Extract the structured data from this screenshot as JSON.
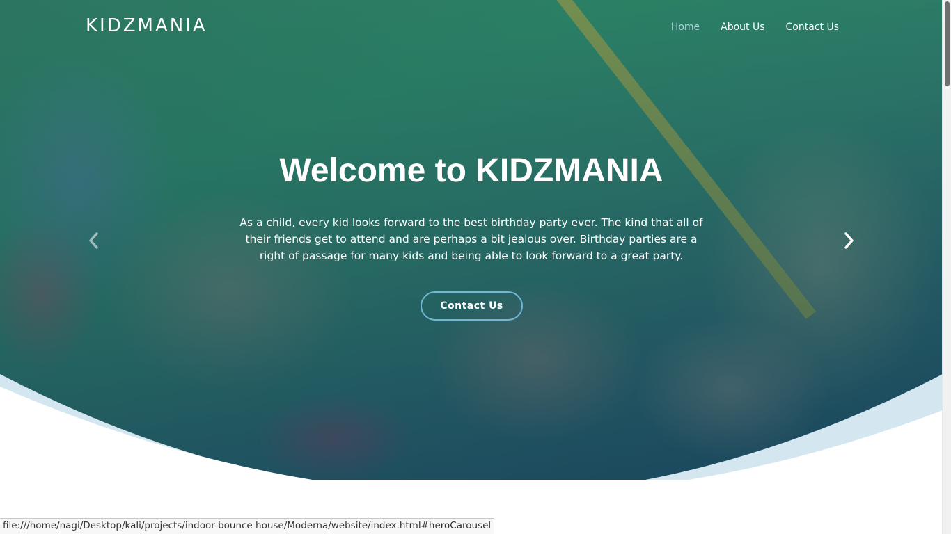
{
  "header": {
    "brand": "KIDZMANIA",
    "nav": [
      {
        "label": "Home",
        "active": true
      },
      {
        "label": "About Us",
        "active": false
      },
      {
        "label": "Contact Us",
        "active": false
      }
    ]
  },
  "hero": {
    "title": "Welcome to KIDZMANIA",
    "text": "As a child, every kid looks forward to the best birthday party ever. The kind that all of their friends get to attend and are perhaps a bit jealous over. Birthday parties are a right of passage for many kids and being able to look forward to a great party.",
    "button_label": "Contact Us",
    "prev_icon": "chevron-left-icon",
    "next_icon": "chevron-right-icon"
  },
  "status_bar": {
    "url": "file:///home/nagi/Desktop/kali/projects/indoor bounce house/Moderna/website/index.html#heroCarousel"
  },
  "colors": {
    "nav_active": "#a8d4da",
    "button_border": "#6fb7d6",
    "wave": "#d4e6ef"
  }
}
